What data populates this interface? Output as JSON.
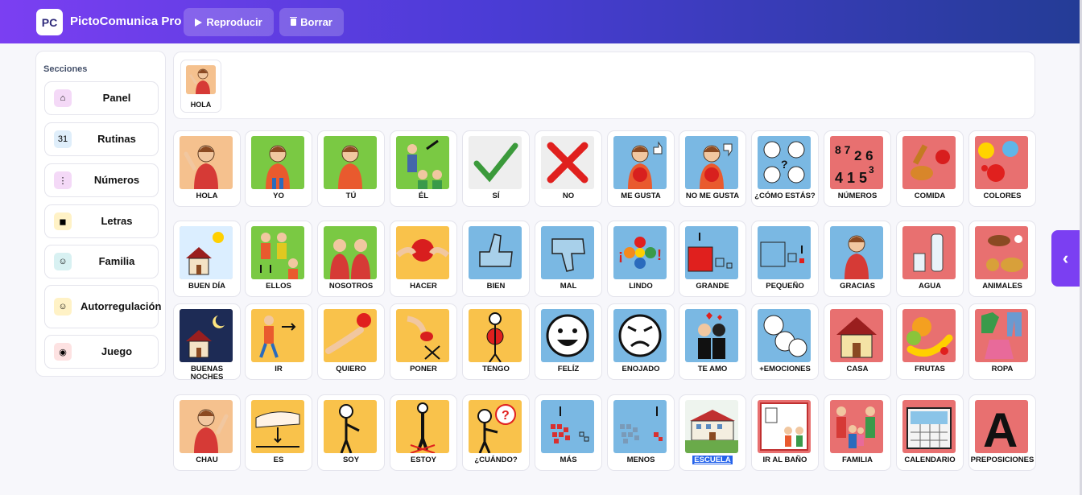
{
  "app": {
    "logo": "PC",
    "title": "PictoComunica Pro"
  },
  "toolbar": {
    "play_label": "Reproducir",
    "clear_label": "Borrar"
  },
  "sidebar": {
    "title": "Secciones",
    "items": [
      {
        "label": "Panel",
        "icon": "house-icon"
      },
      {
        "label": "Rutinas",
        "icon": "calendar-icon"
      },
      {
        "label": "Números",
        "icon": "numbers-icon"
      },
      {
        "label": "Letras",
        "icon": "letters-icon"
      },
      {
        "label": "Familia",
        "icon": "family-icon"
      },
      {
        "label": "Autorregulación",
        "icon": "self-regulation-icon"
      },
      {
        "label": "Juego",
        "icon": "gamepad-icon"
      }
    ]
  },
  "sentence": {
    "items": [
      {
        "label": "HOLA"
      }
    ]
  },
  "colors": {
    "orange": "#f5c18e",
    "green": "#7ac943",
    "grey": "#eeeeee",
    "blue": "#7ab8e3",
    "red": "#e87070",
    "yellow": "#f9c24b"
  },
  "board": {
    "rows": [
      [
        {
          "label": "HOLA",
          "bg": "orange",
          "icon": "person-waving-icon"
        },
        {
          "label": "YO",
          "bg": "green",
          "icon": "person-me-icon"
        },
        {
          "label": "TÚ",
          "bg": "green",
          "icon": "person-you-icon"
        },
        {
          "label": "ÉL",
          "bg": "green",
          "icon": "person-him-icon"
        },
        {
          "label": "SÍ",
          "bg": "grey",
          "icon": "checkmark-icon"
        },
        {
          "label": "NO",
          "bg": "grey",
          "icon": "cross-icon"
        },
        {
          "label": "ME GUSTA",
          "bg": "blue",
          "icon": "thumbs-up-person-icon"
        },
        {
          "label": "NO ME GUSTA",
          "bg": "blue",
          "icon": "thumbs-down-person-icon"
        },
        {
          "label": "¿CÓMO ESTÁS?",
          "bg": "blue",
          "icon": "faces-icon"
        },
        {
          "label": "NÚMEROS",
          "bg": "red",
          "icon": "numbers-icon"
        },
        {
          "label": "COMIDA",
          "bg": "red",
          "icon": "food-icon"
        },
        {
          "label": "COLORES",
          "bg": "red",
          "icon": "paint-splash-icon"
        }
      ],
      [
        {
          "label": "BUEN DÍA",
          "bg": "orange",
          "icon": "house-sun-icon"
        },
        {
          "label": "ELLOS",
          "bg": "green",
          "icon": "people-them-icon"
        },
        {
          "label": "NOSOTROS",
          "bg": "green",
          "icon": "people-us-icon"
        },
        {
          "label": "HACER",
          "bg": "yellow",
          "icon": "hands-ball-icon"
        },
        {
          "label": "BIEN",
          "bg": "blue",
          "icon": "thumb-up-icon"
        },
        {
          "label": "MAL",
          "bg": "blue",
          "icon": "thumb-down-icon"
        },
        {
          "label": "LINDO",
          "bg": "blue",
          "icon": "flower-icon"
        },
        {
          "label": "GRANDE",
          "bg": "blue",
          "icon": "big-square-icon"
        },
        {
          "label": "PEQUEÑO",
          "bg": "blue",
          "icon": "small-square-icon"
        },
        {
          "label": "GRACIAS",
          "bg": "blue",
          "icon": "person-thanks-icon"
        },
        {
          "label": "AGUA",
          "bg": "red",
          "icon": "water-icon"
        },
        {
          "label": "ANIMALES",
          "bg": "red",
          "icon": "animals-icon"
        }
      ],
      [
        {
          "label": "BUENAS NOCHES",
          "bg": "orange",
          "icon": "house-moon-icon"
        },
        {
          "label": "IR",
          "bg": "yellow",
          "icon": "walking-icon"
        },
        {
          "label": "QUIERO",
          "bg": "yellow",
          "icon": "hand-reach-icon"
        },
        {
          "label": "PONER",
          "bg": "yellow",
          "icon": "hand-place-icon"
        },
        {
          "label": "TENGO",
          "bg": "yellow",
          "icon": "person-holding-icon"
        },
        {
          "label": "FELÍZ",
          "bg": "blue",
          "icon": "happy-face-icon"
        },
        {
          "label": "ENOJADO",
          "bg": "blue",
          "icon": "angry-face-icon"
        },
        {
          "label": "TE AMO",
          "bg": "blue",
          "icon": "love-icon"
        },
        {
          "label": "+EMOCIONES",
          "bg": "blue",
          "icon": "emotions-icon"
        },
        {
          "label": "CASA",
          "bg": "red",
          "icon": "house-icon"
        },
        {
          "label": "FRUTAS",
          "bg": "red",
          "icon": "fruits-icon"
        },
        {
          "label": "ROPA",
          "bg": "red",
          "icon": "clothes-icon"
        }
      ],
      [
        {
          "label": "CHAU",
          "bg": "orange",
          "icon": "person-bye-icon"
        },
        {
          "label": "ES",
          "bg": "yellow",
          "icon": "hand-is-icon"
        },
        {
          "label": "SOY",
          "bg": "yellow",
          "icon": "person-i-am-icon"
        },
        {
          "label": "ESTOY",
          "bg": "yellow",
          "icon": "person-standing-icon"
        },
        {
          "label": "¿CUÁNDO?",
          "bg": "yellow",
          "icon": "person-question-icon"
        },
        {
          "label": "MÁS",
          "bg": "blue",
          "icon": "more-icon"
        },
        {
          "label": "MENOS",
          "bg": "blue",
          "icon": "less-icon"
        },
        {
          "label": "ESCUELA",
          "bg": "white",
          "icon": "school-icon",
          "highlight": true
        },
        {
          "label": "IR AL BAÑO",
          "bg": "red",
          "icon": "bathroom-icon"
        },
        {
          "label": "FAMILIA",
          "bg": "red",
          "icon": "family-icon"
        },
        {
          "label": "CALENDARIO",
          "bg": "red",
          "icon": "calendar-icon"
        },
        {
          "label": "PREPOSICIONES",
          "bg": "red",
          "icon": "letter-a-icon"
        }
      ]
    ]
  },
  "panel_toggle": {
    "label": "‹"
  }
}
